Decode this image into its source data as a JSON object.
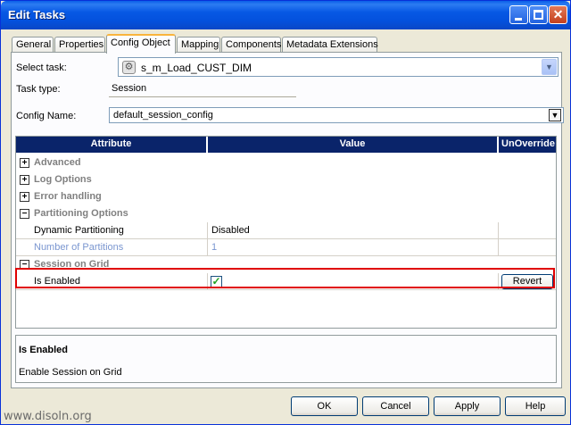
{
  "window": {
    "title": "Edit Tasks"
  },
  "titlebar": {
    "minimize_glyph": "",
    "maximize_glyph": "",
    "close_glyph": "✕"
  },
  "tabs": [
    {
      "label": "General"
    },
    {
      "label": "Properties"
    },
    {
      "label": "Config Object"
    },
    {
      "label": "Mapping"
    },
    {
      "label": "Components"
    },
    {
      "label": "Metadata Extensions"
    }
  ],
  "form": {
    "select_task_label": "Select task:",
    "select_task_value": "s_m_Load_CUST_DIM",
    "task_type_label": "Task type:",
    "task_type_value": "Session",
    "config_name_label": "Config Name:",
    "config_name_value": "default_session_config"
  },
  "grid": {
    "headers": {
      "attribute": "Attribute",
      "value": "Value",
      "unoverride": "UnOverride"
    },
    "sections": {
      "advanced": {
        "label": "Advanced",
        "expander": "+"
      },
      "log_options": {
        "label": "Log Options",
        "expander": "+"
      },
      "error_handling": {
        "label": "Error handling",
        "expander": "+"
      },
      "partitioning_options": {
        "label": "Partitioning Options",
        "expander": "−"
      },
      "session_on_grid": {
        "label": "Session on Grid",
        "expander": "−"
      }
    },
    "rows": {
      "dynamic_partitioning": {
        "attribute": "Dynamic Partitioning",
        "value": "Disabled"
      },
      "number_of_partitions": {
        "attribute": "Number of Partitions",
        "value": "1"
      },
      "is_enabled": {
        "attribute": "Is Enabled",
        "checked_glyph": "✓",
        "revert": "Revert"
      }
    }
  },
  "description": {
    "title": "Is Enabled",
    "text": "Enable Session on Grid"
  },
  "buttons": {
    "ok": "OK",
    "cancel": "Cancel",
    "apply": "Apply",
    "help": "Help"
  },
  "watermark": "www.disoln.org",
  "colors": {
    "header_bg": "#0a246a",
    "highlight": "#e00000",
    "disabled_text": "#7a96d0",
    "section_text": "#808080"
  }
}
